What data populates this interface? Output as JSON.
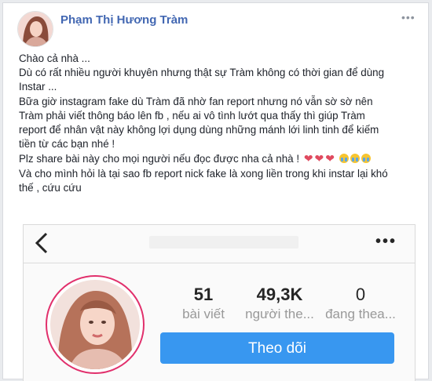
{
  "post": {
    "author_name": "Phạm Thị Hương Tràm",
    "more_label": "•••",
    "lines": [
      "Chào cả nhà ...",
      "Dù có rất nhiều người khuyên nhưng thật sự Tràm không có thời gian để dùng",
      "Instar ...",
      "Bữa giờ instagram fake dù Tràm đã nhờ fan report nhưng nó vẫn sờ sờ nên",
      "Tràm phải viết thông báo lên fb , nếu ai vô tình lướt qua thấy thì giúp Tràm",
      "report để nhân vật này không lợi dụng dùng những mánh lới linh tinh để kiếm",
      "tiền từ các bạn nhé !",
      "Plz share bài này cho mọi người nếu đọc được nha cả nhà !",
      "Và cho mình hỏi là tại sao fb report nick fake là xong liền trong khi instar lại khó",
      "thế , cứu cứu"
    ],
    "emoji": [
      "heart-emoji",
      "heart-emoji",
      "heart-emoji",
      "crying-emoji",
      "crying-emoji",
      "crying-emoji"
    ]
  },
  "instagram": {
    "back_icon": "chevron-left-icon",
    "more_label": "•••",
    "stats": [
      {
        "value": "51",
        "label": "bài viết"
      },
      {
        "value": "49,3K",
        "label": "người the..."
      },
      {
        "value": "0",
        "label": "đang thea..."
      }
    ],
    "follow_label": "Theo dõi"
  },
  "colors": {
    "author": "#4267b2",
    "follow_button": "#3897f0",
    "heart": "#e04a5f"
  }
}
